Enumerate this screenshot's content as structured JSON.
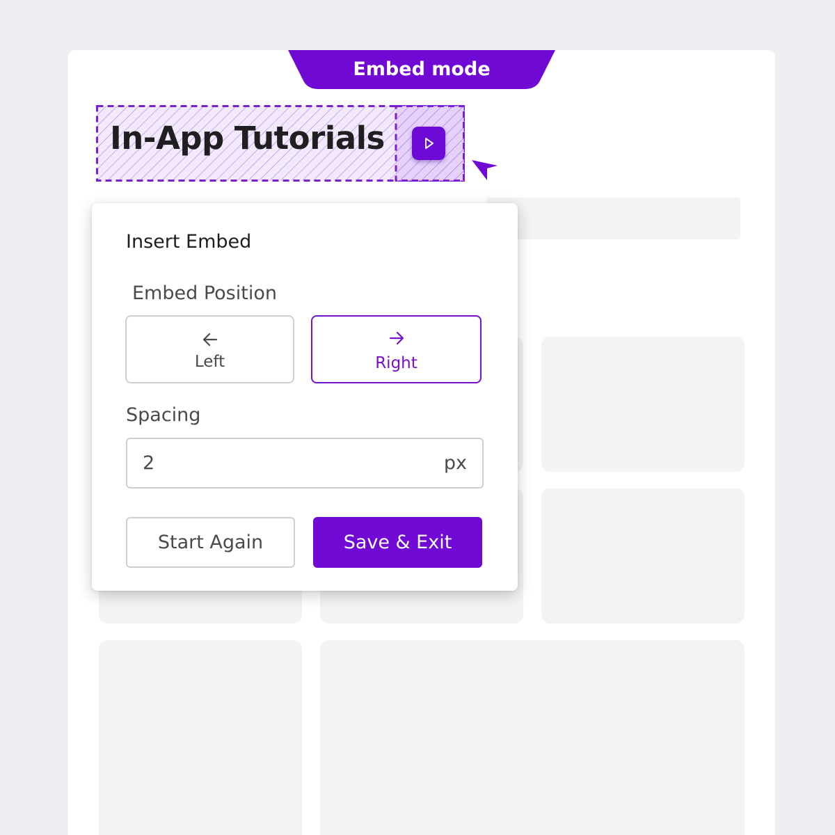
{
  "app": {
    "mode_label": "Embed mode",
    "heading": "In-App Tutorials",
    "embed_icon": "play-icon",
    "cursor_icon": "pointer-cursor-icon"
  },
  "dialog": {
    "title": "Insert Embed",
    "position": {
      "label": "Embed Position",
      "options": [
        {
          "label": "Left",
          "icon": "arrow-left-icon",
          "selected": false
        },
        {
          "label": "Right",
          "icon": "arrow-right-icon",
          "selected": true
        }
      ]
    },
    "spacing": {
      "label": "Spacing",
      "value": "2",
      "unit": "px"
    },
    "buttons": {
      "secondary": "Start Again",
      "primary": "Save & Exit"
    }
  },
  "colors": {
    "accent": "#7109d4",
    "accent_light": "#e9d8fb",
    "page_bg": "#efeff3",
    "placeholder": "#f2f3f3",
    "border": "#cfcfd2"
  }
}
